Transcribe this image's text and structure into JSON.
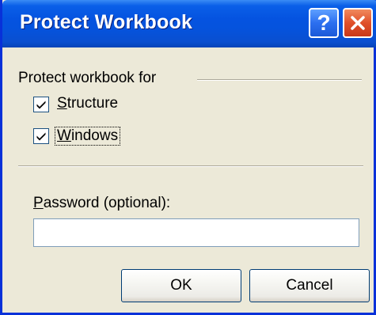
{
  "window": {
    "title": "Protect Workbook",
    "help_symbol": "?",
    "help_icon": "help-icon",
    "close_icon": "close-icon"
  },
  "group": {
    "label": "Protect workbook for",
    "options": [
      {
        "label_access": "S",
        "label_rest": "tructure",
        "checked": true
      },
      {
        "label_access": "W",
        "label_rest": "indows",
        "checked": true
      }
    ]
  },
  "password": {
    "label_access": "P",
    "label_rest": "assword (optional):",
    "value": "",
    "placeholder": ""
  },
  "buttons": {
    "ok_label": "OK",
    "cancel_label": "Cancel"
  },
  "colors": {
    "titlebar": "#0553e0",
    "dialog_bg": "#ece9d8",
    "close_button": "#e0502a",
    "button_border": "#003c74"
  }
}
